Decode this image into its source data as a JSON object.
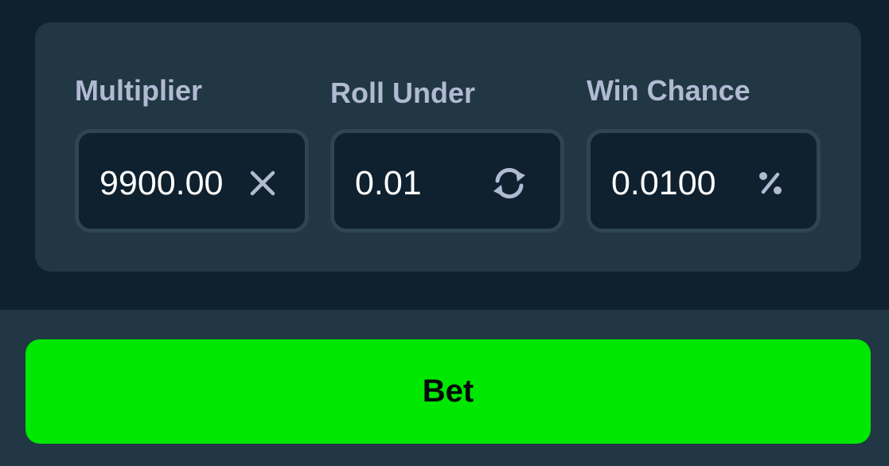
{
  "fields": {
    "multiplier": {
      "label": "Multiplier",
      "value": "9900.00",
      "icon": "close-icon"
    },
    "roll_under": {
      "label": "Roll Under",
      "value": "0.01",
      "icon": "refresh-icon"
    },
    "win_chance": {
      "label": "Win Chance",
      "value": "0.0100",
      "icon": "percent-icon"
    }
  },
  "bet_button": {
    "label": "Bet"
  },
  "colors": {
    "background": "#0f212e",
    "panel": "#213743",
    "input_border": "#2f4553",
    "label_text": "#b1bad3",
    "accent_green": "#00e701"
  }
}
